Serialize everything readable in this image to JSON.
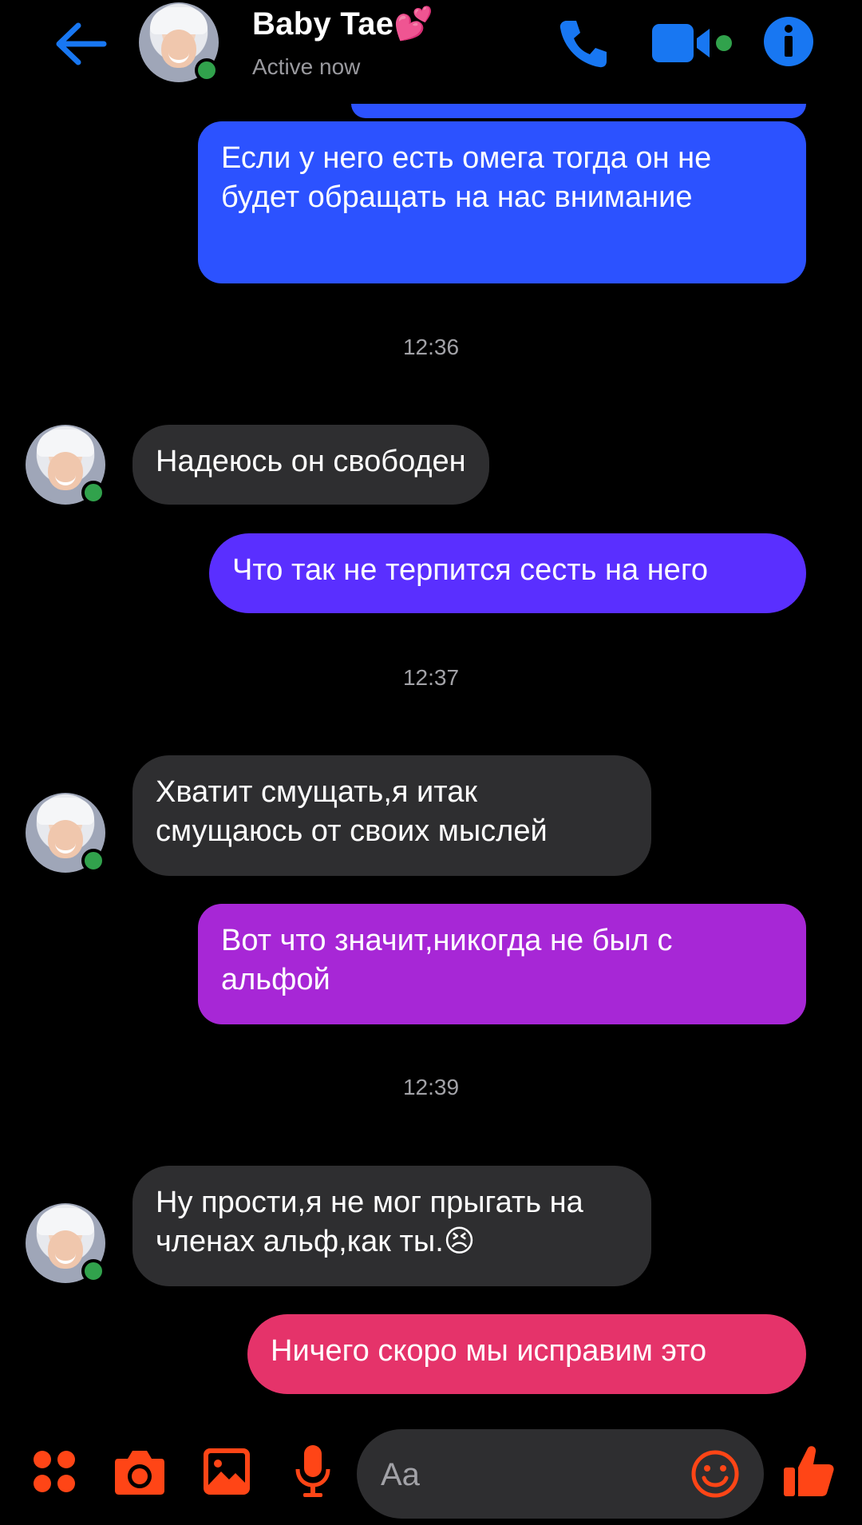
{
  "header": {
    "contact_name": "Baby Tae",
    "contact_emoji": "💕",
    "status": "Active now"
  },
  "messages": [
    {
      "from": "me",
      "text": "Если у него есть  омега тогда он не будет обращать на нас внимание",
      "color": "#2c52ff"
    },
    {
      "timestamp": "12:36"
    },
    {
      "from": "contact",
      "text": "Надеюсь он свободен"
    },
    {
      "from": "me",
      "text": "Что так не терпится сесть на него",
      "color": "#5a2fff"
    },
    {
      "timestamp": "12:37"
    },
    {
      "from": "contact",
      "text": "Хватит смущать,я итак смущаюсь от своих мыслей"
    },
    {
      "from": "me",
      "text": "Вот что значит,никогда не был с альфой",
      "color": "#a727d6"
    },
    {
      "timestamp": "12:39"
    },
    {
      "from": "contact",
      "text": "Ну прости,я не мог прыгать на членах альф,как ты.",
      "emoji": "😣"
    },
    {
      "from": "me",
      "text": "Ничего скоро мы исправим это",
      "color": "#e5336a"
    }
  ],
  "composer": {
    "placeholder": "Aa"
  },
  "colors": {
    "header_accent": "#1877f2",
    "bottom_accent": "#ff4516",
    "incoming_bubble": "#2e2e30",
    "online": "#31a24c"
  },
  "icons": {
    "header": [
      "back-arrow-icon",
      "phone-icon",
      "video-camera-icon",
      "info-icon"
    ],
    "bottom": [
      "apps-icon",
      "camera-icon",
      "gallery-icon",
      "microphone-icon",
      "emoji-icon",
      "thumbs-up-icon"
    ]
  }
}
